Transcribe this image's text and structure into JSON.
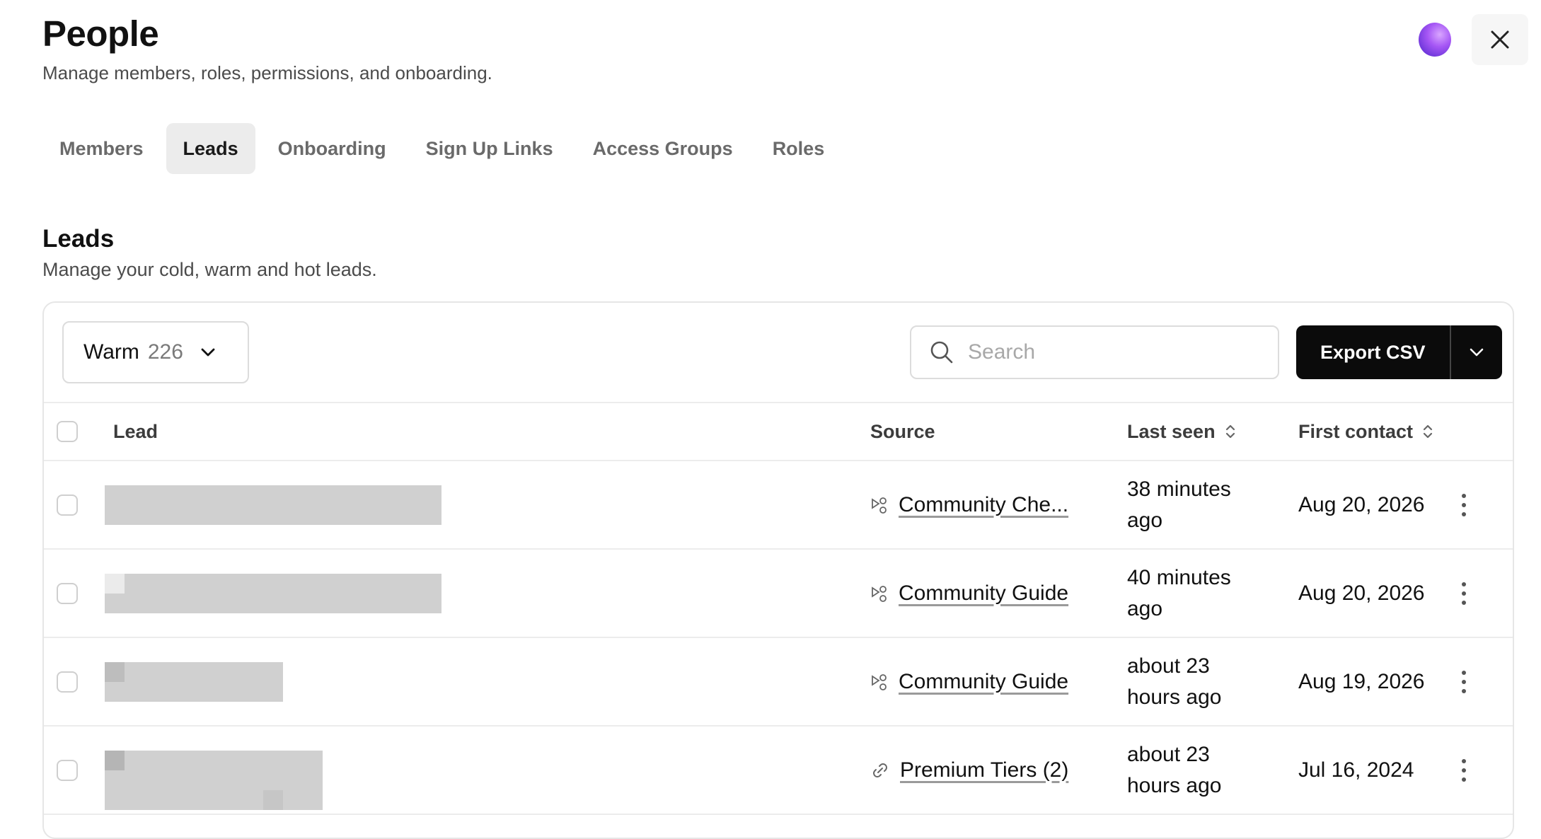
{
  "header": {
    "title": "People",
    "subtitle": "Manage members, roles, permissions, and onboarding."
  },
  "tabs": [
    {
      "label": "Members",
      "active": false
    },
    {
      "label": "Leads",
      "active": true
    },
    {
      "label": "Onboarding",
      "active": false
    },
    {
      "label": "Sign Up Links",
      "active": false
    },
    {
      "label": "Access Groups",
      "active": false
    },
    {
      "label": "Roles",
      "active": false
    }
  ],
  "section": {
    "title": "Leads",
    "subtitle": "Manage your cold, warm and hot leads."
  },
  "toolbar": {
    "filter_label": "Warm",
    "filter_count": "226",
    "search_placeholder": "Search",
    "export_label": "Export CSV"
  },
  "columns": {
    "lead": "Lead",
    "source": "Source",
    "last_seen": "Last seen",
    "first_contact": "First contact"
  },
  "rows": [
    {
      "source": "Community Che...",
      "source_icon": "share-nodes-icon",
      "last_seen": "38 minutes ago",
      "first_contact": "Aug 20, 2026"
    },
    {
      "source": "Community Guide",
      "source_icon": "share-nodes-icon",
      "last_seen": "40 minutes ago",
      "first_contact": "Aug 20, 2026"
    },
    {
      "source": "Community Guide",
      "source_icon": "share-nodes-icon",
      "last_seen": "about 23 hours ago",
      "first_contact": "Aug 19, 2026"
    },
    {
      "source": "Premium Tiers (2)",
      "source_icon": "link-icon",
      "last_seen": "about 23 hours ago",
      "first_contact": "Jul 16, 2024"
    }
  ],
  "colors": {
    "accent": "#0b0b0b",
    "orb": "#a657f5"
  }
}
